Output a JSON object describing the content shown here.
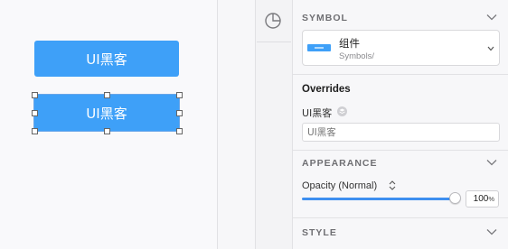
{
  "canvas": {
    "button_top_label": "UI黑客",
    "button_selected_label": "UI黑客"
  },
  "inspector": {
    "symbol": {
      "title": "SYMBOL",
      "name": "组件",
      "path": "Symbols/"
    },
    "overrides": {
      "title": "Overrides",
      "field_label": "UI黑客",
      "placeholder": "UI黑客"
    },
    "appearance": {
      "title": "APPEARANCE",
      "opacity_label": "Opacity (Normal)",
      "opacity_value": "100",
      "opacity_unit": "%",
      "opacity_fraction": 1.0
    },
    "style": {
      "title": "STYLE"
    }
  },
  "colors": {
    "accent": "#3ea0f8",
    "slider": "#3e8ff0"
  },
  "icons": [
    "pie-chart-icon",
    "chevron-down-icon",
    "layers-icon",
    "updown-arrows-icon"
  ]
}
